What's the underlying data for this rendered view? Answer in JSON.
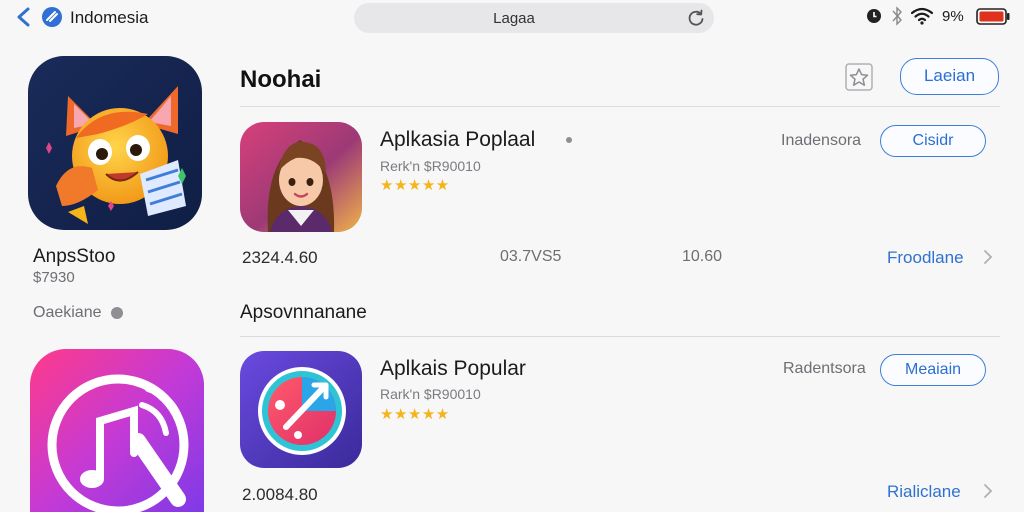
{
  "nav": {
    "region": "Indomesia",
    "url": "Lagaa",
    "battery": "9%"
  },
  "left": {
    "name": "AnpsStoo",
    "price": "$7930",
    "status": "Oaekiane"
  },
  "section1": {
    "title": "Noohai",
    "header_button": "Laeian",
    "app": {
      "name": "Aplkasia Poplaal",
      "rank": "Rerk'n $R90010",
      "stars": "★★★★★",
      "region": "Inadensora",
      "button": "Cisidr"
    },
    "stats": {
      "size": "2324.4.60",
      "date": "03.7VS5",
      "count": "10.60",
      "link": "Froodlane"
    }
  },
  "section2": {
    "title": "Apsovnnanane",
    "app": {
      "name": "Aplkais Popular",
      "rank": "Rark'n $R90010",
      "stars": "★★★★★",
      "region": "Radentsora",
      "button": "Meaiain"
    },
    "stats": {
      "size": "2.0084.80",
      "link": "Rialiclane"
    }
  },
  "colors": {
    "accent": "#2f72cf",
    "star": "#f4b41a",
    "battery_low": "#e0301e"
  },
  "icons": [
    "back-arrow",
    "globe",
    "reload",
    "clock",
    "bluetooth",
    "wifi",
    "battery",
    "star-bookmark",
    "chevron-right"
  ]
}
